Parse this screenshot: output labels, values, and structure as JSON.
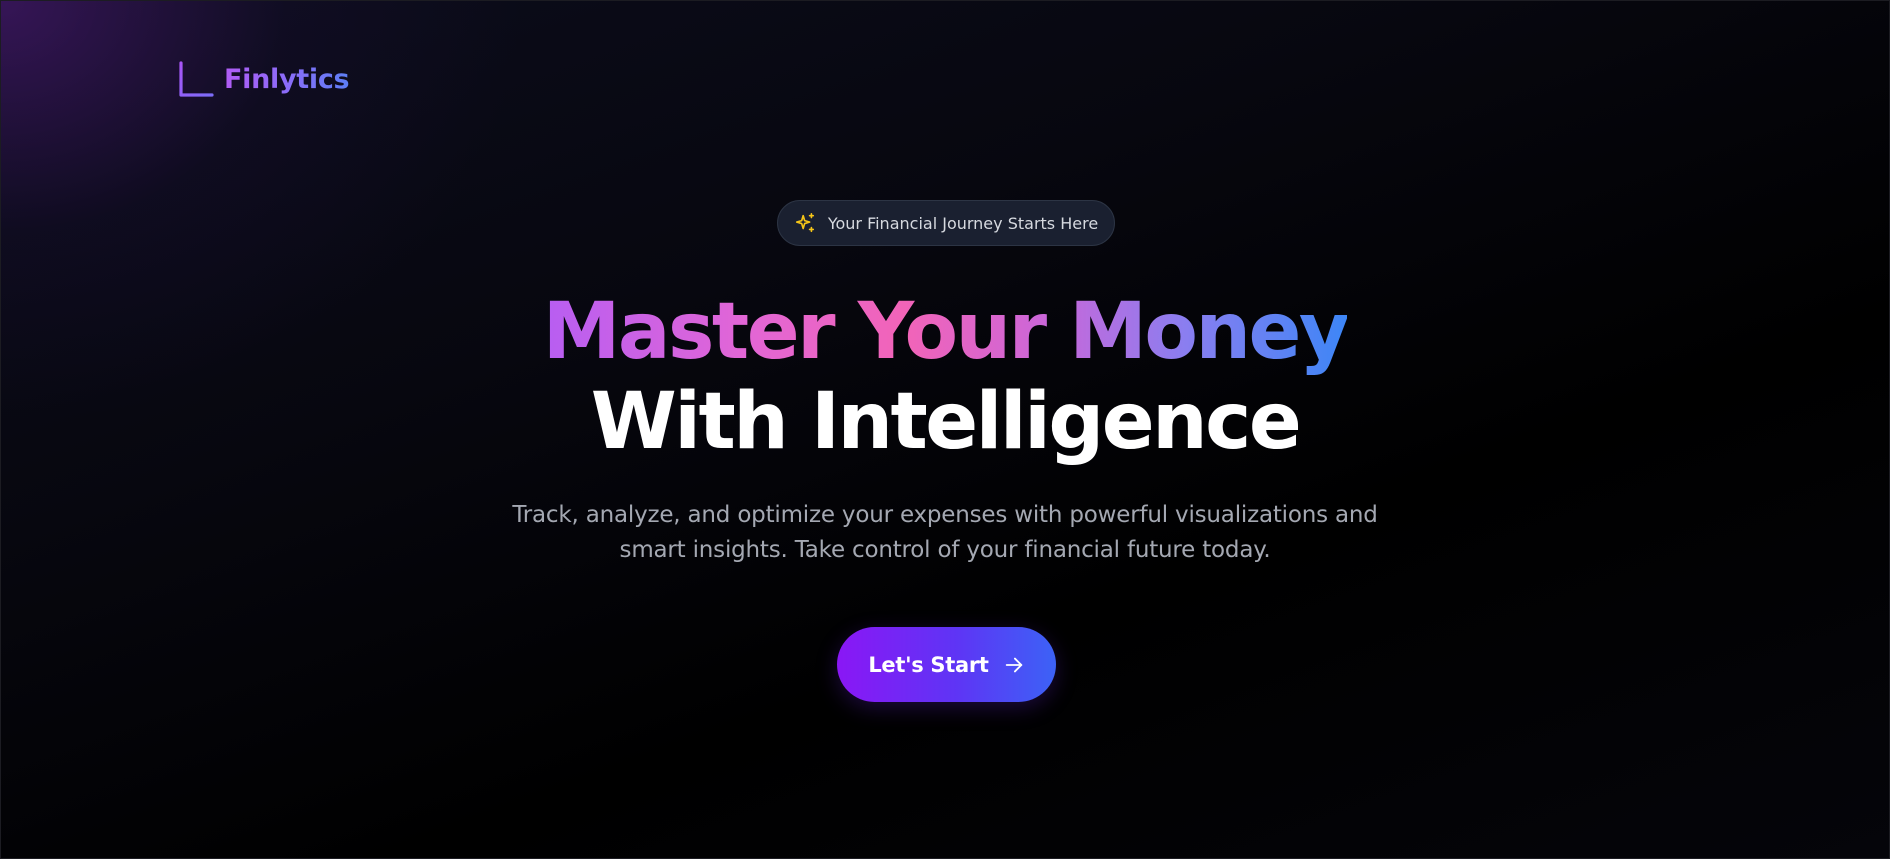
{
  "brand": {
    "name": "Finlytics",
    "icon": "bar-chart-icon"
  },
  "badge": {
    "icon": "sparkles-icon",
    "text": "Your Financial Journey Starts Here"
  },
  "hero": {
    "headline_line1": "Master Your Money",
    "headline_line2": "With Intelligence",
    "subtitle": "Track, analyze, and optimize your expenses with powerful visualizations and smart insights. Take control of your financial future today."
  },
  "cta": {
    "label": "Let's Start",
    "icon": "arrow-right-icon"
  },
  "colors": {
    "accent_purple": "#8a17f5",
    "accent_blue": "#3c62f6",
    "accent_pink": "#f264b8",
    "sparkle_yellow": "#f5c518"
  }
}
